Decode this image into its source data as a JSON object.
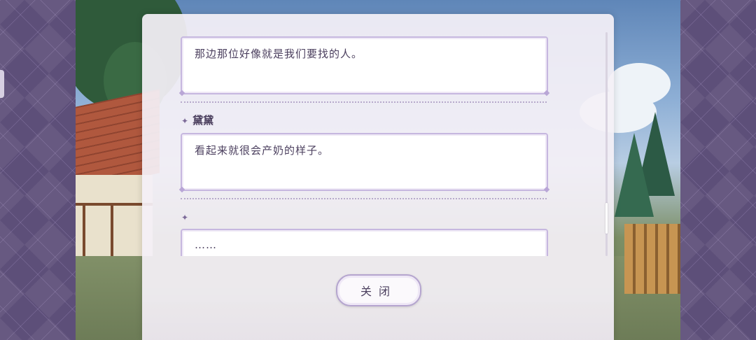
{
  "dialog_log": {
    "entries": [
      {
        "speaker": "",
        "text": "那边那位好像就是我们要找的人。"
      },
      {
        "speaker": "黛黛",
        "text": "看起来就很会产奶的样子。"
      },
      {
        "speaker": "",
        "text": "……"
      }
    ],
    "speaker_marker": "✦"
  },
  "buttons": {
    "close_label": "关闭"
  },
  "colors": {
    "accent": "#b5a5cf",
    "text": "#4b3f5e",
    "side_pattern": "#5d4f79"
  }
}
